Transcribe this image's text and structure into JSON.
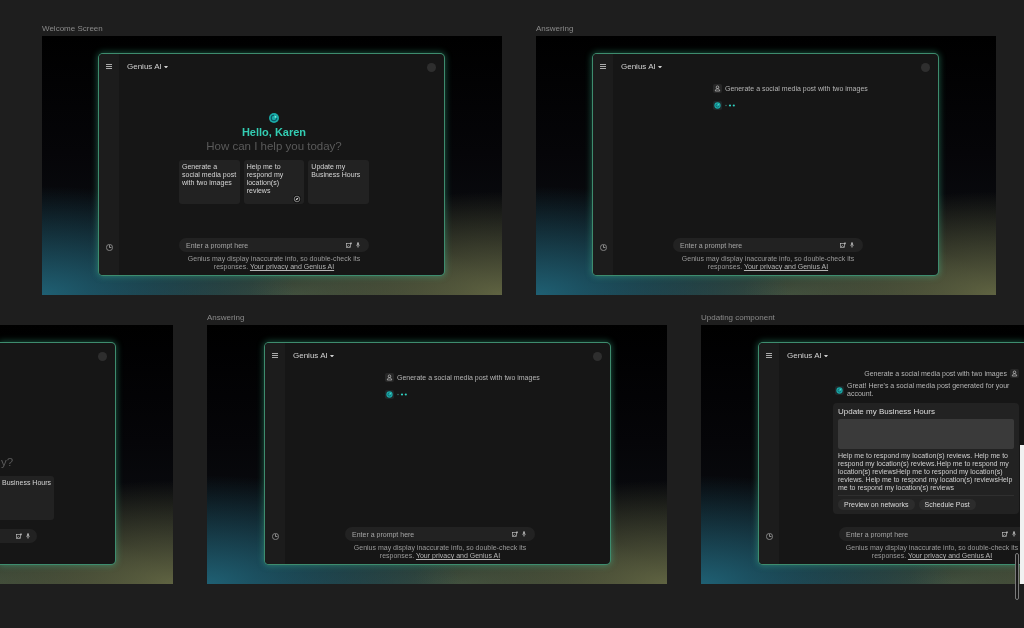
{
  "artboards": [
    {
      "label": "Welcome Screen",
      "kind": "welcome",
      "app": {
        "title": "Genius AI",
        "avatar": true
      },
      "greeting": "Hello, Karen",
      "question": "How can I help you today?",
      "suggestions": [
        {
          "text": "Generate a social media post with two images",
          "kind": "plain"
        },
        {
          "text": "Help me to respond my location(s) reviews",
          "kind": "compass"
        },
        {
          "text": "Update my Business Hours",
          "kind": "plain"
        }
      ],
      "prompt": {
        "placeholder": "Enter a prompt here"
      },
      "disclaimer": {
        "text": "Genius may display inaccurate info, so double-check its responses.",
        "link": "Your privacy and Genius AI"
      }
    },
    {
      "label": "Answering",
      "kind": "answering",
      "app": {
        "title": "Genius AI",
        "avatar": true
      },
      "messages": [
        {
          "kind": "user",
          "text": "Generate a social media post with two images"
        },
        {
          "kind": "typing"
        }
      ],
      "prompt": {
        "placeholder": "Enter a prompt here"
      },
      "disclaimer": {
        "text": "Genius may display inaccurate info, so double-check its responses.",
        "link": "Your privacy and Genius AI"
      }
    },
    {
      "kind": "welcome_cropped",
      "app": {
        "avatar": true
      },
      "question": "y?",
      "suggestions": [
        {
          "text": "Business Hours",
          "kind": "plain"
        }
      ]
    },
    {
      "label": "Answering",
      "kind": "answering",
      "app": {
        "title": "Genius AI",
        "avatar": true
      },
      "messages": [
        {
          "kind": "user",
          "text": "Generate a social media post with two images"
        },
        {
          "kind": "typing"
        }
      ],
      "prompt": {
        "placeholder": "Enter a prompt here"
      },
      "disclaimer": {
        "text": "Genius may display inaccurate info, so double-check its responses.",
        "link": "Your privacy and Genius AI"
      }
    },
    {
      "label": "Updating component",
      "kind": "updating",
      "app": {
        "title": "Genius AI"
      },
      "messages": [
        {
          "kind": "user",
          "text": "Generate a social media post with two images"
        },
        {
          "kind": "bot",
          "text": "Great! Here's a social media post generated for your account."
        },
        {
          "kind": "post_card",
          "title": "Update my Business Hours",
          "body": "Help me to respond my location(s) reviews. Help me to respond my location(s) reviews.Help me to respond my location(s) reviewsHelp me to respond my location(s) reviews. Help me to respond my location(s) reviewsHelp me to respond my location(s) reviews",
          "actions": [
            {
              "label": "Preview on networks"
            },
            {
              "label": "Schedule Post"
            }
          ]
        }
      ],
      "prompt": {
        "placeholder": "Enter a prompt here"
      },
      "disclaimer": {
        "text": "Genius may display inaccurate info, so double-check its responses.",
        "link": "Your privacy and Genius AI"
      }
    }
  ]
}
